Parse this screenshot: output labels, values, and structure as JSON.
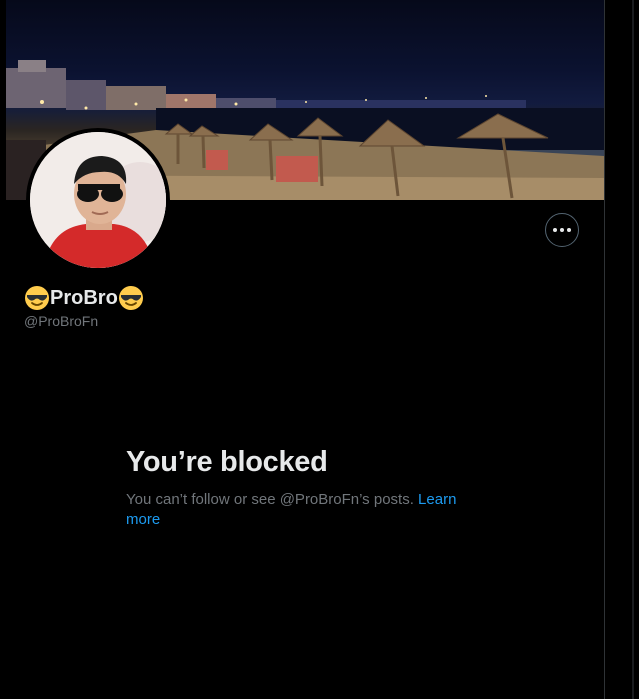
{
  "profile": {
    "display_name": "ProBro",
    "name_emoji": "smiling-face-with-sunglasses-icon",
    "handle": "@ProBroFn",
    "banner": "night-beach-with-straw-umbrellas-image",
    "avatar": "person-with-sunglasses-avatar"
  },
  "actions": {
    "more_icon": "more-options-icon"
  },
  "blocked": {
    "title": "You’re blocked",
    "message": "You can’t follow or see @ProBroFn’s posts.",
    "link_label": "Learn more"
  },
  "colors": {
    "background": "#000000",
    "primary_text": "#e7e9ea",
    "secondary_text": "#71767b",
    "link": "#1d9bf0",
    "border": "#2f3336"
  }
}
